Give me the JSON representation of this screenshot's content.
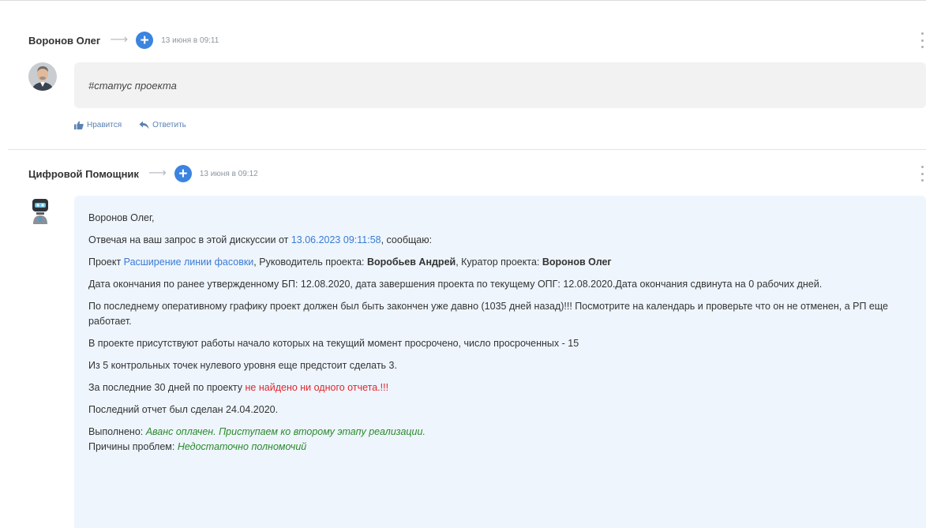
{
  "post1": {
    "author": "Воронов Олег",
    "time": "13 июня в 09:11",
    "text": "#статус проекта",
    "like_label": "Нравится",
    "reply_label": "Ответить"
  },
  "post2": {
    "author": "Цифровой Помощник",
    "time": "13 июня в 09:12",
    "greeting": "Воронов Олег,",
    "line2_pre": "Отвечая на ваш запрос в этой дискуссии от ",
    "line2_link": "13.06.2023 09:11:58",
    "line2_post": ", сообщаю:",
    "line3_pre": "Проект ",
    "line3_link": "Расширение линии фасовки",
    "line3_mid1": ", Руководитель проекта: ",
    "line3_manager": "Воробьев Андрей",
    "line3_mid2": ", Куратор проекта: ",
    "line3_curator": "Воронов Олег",
    "line4": "Дата окончания по ранее утвержденному БП: 12.08.2020, дата завершения проекта по текущему ОПГ: 12.08.2020.Дата окончания сдвинута на 0 рабочих дней.",
    "line5_warning": "По последнему оперативному графику проект должен был быть закончен уже давно (1035 дней назад)!!! Посмотрите на календарь и проверьте что он не отменен, а РП еще работает.",
    "line6": "В проекте присутствуют работы начало которых на текущий момент просрочено, число просроченных - 15",
    "line7": "Из 5 контрольных точек нулевого уровня еще предстоит сделать 3.",
    "line8_pre": "За последние 30 дней по проекту ",
    "line8_warning": "не найдено ни одного отчета.!!!",
    "line9": "Последний отчет был сделан 24.04.2020.",
    "done_label": "Выполнено: ",
    "done_value": "Аванс оплачен. Приступаем ко второму этапу реализации.",
    "problems_label": "Причины проблем: ",
    "problems_value": "Недостаточно полномочий"
  },
  "colors": {
    "accent": "#3b84e0",
    "link": "#3a7bd5",
    "warning": "#e0262b",
    "success": "#2b8a2b",
    "bot_bubble": "#eef5fd",
    "user_bubble": "#f2f2f3"
  },
  "icons": [
    "arrow-right-icon",
    "plus-circle-icon",
    "kebab-menu-icon",
    "thumbs-up-icon",
    "reply-icon"
  ]
}
